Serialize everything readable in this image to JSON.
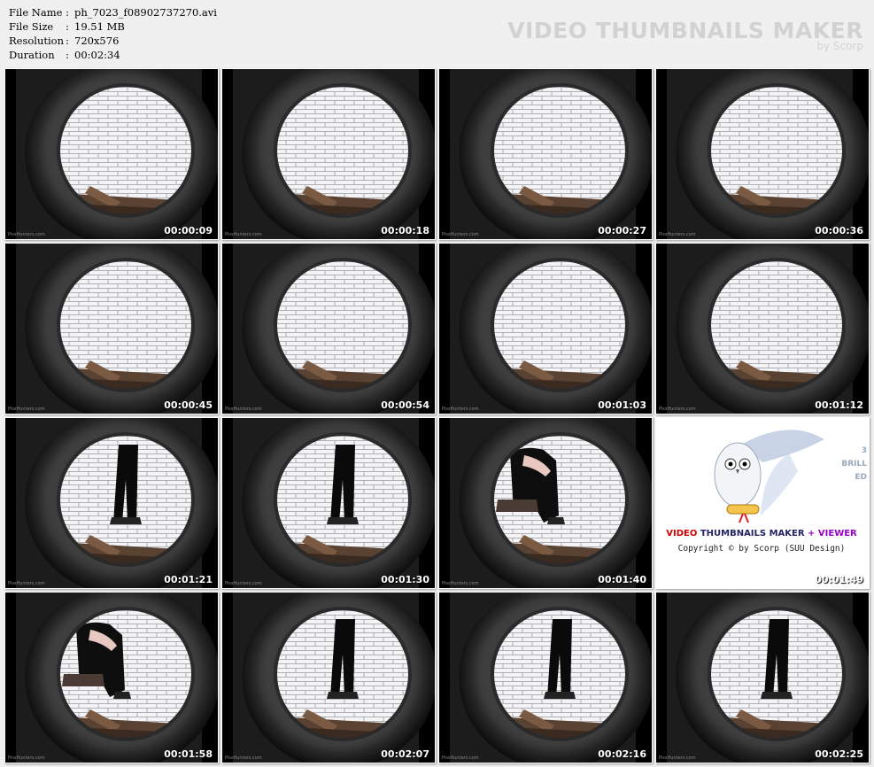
{
  "file_info": {
    "rows": [
      {
        "label": "File Name",
        "value": "ph_7023_f08902737270.avi"
      },
      {
        "label": "File Size",
        "value": "19.51 MB"
      },
      {
        "label": "Resolution",
        "value": "720x576"
      },
      {
        "label": "Duration",
        "value": "00:02:34"
      }
    ]
  },
  "brand": {
    "title": "VIDEO THUMBNAILS MAKER",
    "by": "by Scorp"
  },
  "watermark": "PissHunters.com",
  "thumbnails": [
    {
      "time": "00:00:09",
      "scene": "empty"
    },
    {
      "time": "00:00:18",
      "scene": "empty"
    },
    {
      "time": "00:00:27",
      "scene": "empty"
    },
    {
      "time": "00:00:36",
      "scene": "empty"
    },
    {
      "time": "00:00:45",
      "scene": "empty"
    },
    {
      "time": "00:00:54",
      "scene": "empty"
    },
    {
      "time": "00:01:03",
      "scene": "empty"
    },
    {
      "time": "00:01:12",
      "scene": "empty"
    },
    {
      "time": "00:01:21",
      "scene": "standing"
    },
    {
      "time": "00:01:30",
      "scene": "standing"
    },
    {
      "time": "00:01:40",
      "scene": "squatting"
    },
    {
      "time": "00:01:49",
      "scene": "logo"
    },
    {
      "time": "00:01:58",
      "scene": "squatting"
    },
    {
      "time": "00:02:07",
      "scene": "standing"
    },
    {
      "time": "00:02:16",
      "scene": "standing"
    },
    {
      "time": "00:02:25",
      "scene": "standing"
    }
  ],
  "logo_tile": {
    "line1_a": "VIDEO",
    "line1_b": "THUMBNAILS MAKER",
    "line1_c": "+ VIEWER",
    "copyright": "Copyright © by Scorp (SUU Design)",
    "side": [
      "3",
      "BRILL",
      "ED"
    ]
  },
  "colors": {
    "background": "#f0f0f0",
    "brand_text": "#d2d2d2"
  }
}
